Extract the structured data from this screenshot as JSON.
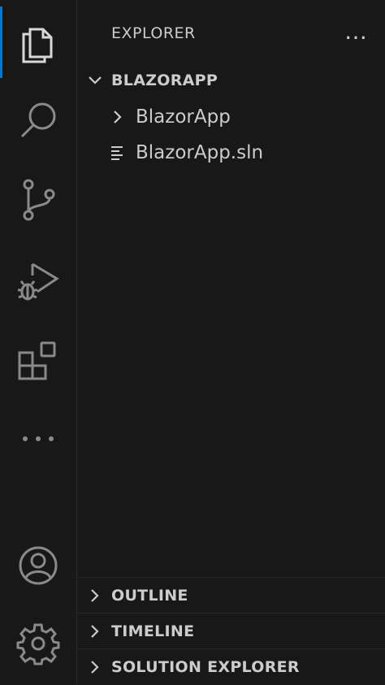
{
  "activity_bar": {
    "items": [
      {
        "name": "explorer-icon"
      },
      {
        "name": "search-icon"
      },
      {
        "name": "source-control-icon"
      },
      {
        "name": "run-debug-icon"
      },
      {
        "name": "extensions-icon"
      },
      {
        "name": "more-icon"
      },
      {
        "name": "accounts-icon"
      },
      {
        "name": "settings-gear-icon"
      }
    ],
    "accent": "#0078d4"
  },
  "sidebar": {
    "title": "EXPLORER",
    "more_label": "…",
    "folder": {
      "title": "BLAZORAPP",
      "expanded": true
    },
    "tree": [
      {
        "label": "BlazorApp",
        "type": "folder",
        "expanded": false
      },
      {
        "label": "BlazorApp.sln",
        "type": "file"
      }
    ],
    "sections": [
      {
        "title": "OUTLINE"
      },
      {
        "title": "TIMELINE"
      },
      {
        "title": "SOLUTION EXPLORER"
      }
    ]
  }
}
